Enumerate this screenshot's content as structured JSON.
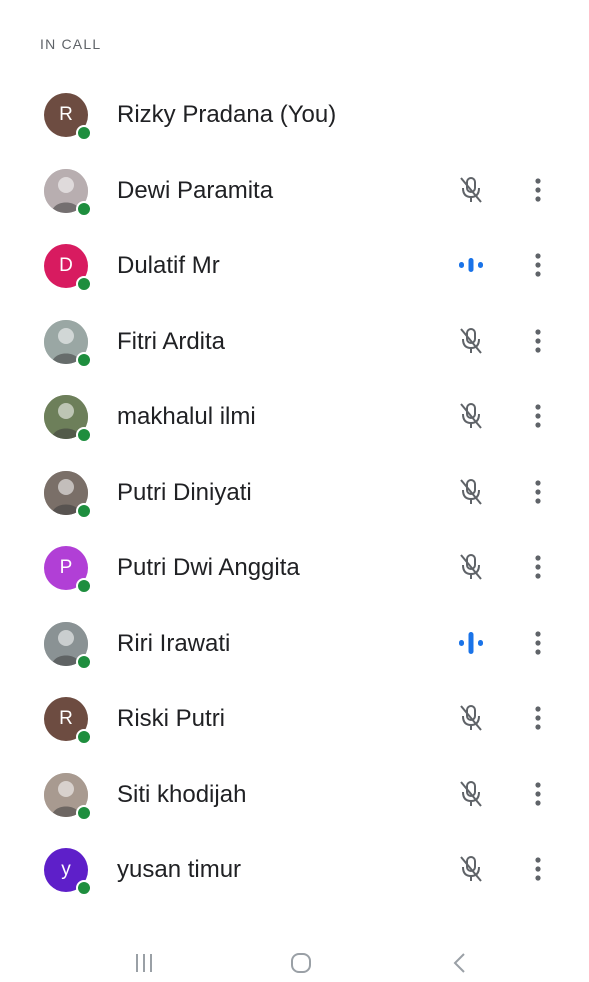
{
  "section": {
    "title": "IN CALL"
  },
  "participants": [
    {
      "name": "Rizky Pradana (You)",
      "avatar_type": "letter",
      "initial": "R",
      "avatar_color": "#6d4c41",
      "mic": "none"
    },
    {
      "name": "Dewi Paramita",
      "avatar_type": "photo",
      "initial": "",
      "avatar_color": "#b8aeb0",
      "mic": "muted"
    },
    {
      "name": "Dulatif Mr",
      "avatar_type": "letter",
      "initial": "D",
      "avatar_color": "#d81b60",
      "mic": "speaking"
    },
    {
      "name": "Fitri Ardita",
      "avatar_type": "photo",
      "initial": "",
      "avatar_color": "#9aa7a4",
      "mic": "muted"
    },
    {
      "name": "makhalul ilmi",
      "avatar_type": "photo",
      "initial": "",
      "avatar_color": "#6d7f5a",
      "mic": "muted"
    },
    {
      "name": "Putri Diniyati",
      "avatar_type": "photo",
      "initial": "",
      "avatar_color": "#7a6f68",
      "mic": "muted"
    },
    {
      "name": "Putri Dwi Anggita",
      "avatar_type": "letter",
      "initial": "P",
      "avatar_color": "#b13fd6",
      "mic": "muted"
    },
    {
      "name": "Riri Irawati",
      "avatar_type": "photo",
      "initial": "",
      "avatar_color": "#8a9294",
      "mic": "speaking"
    },
    {
      "name": "Riski Putri",
      "avatar_type": "letter",
      "initial": "R",
      "avatar_color": "#6d4c41",
      "mic": "muted"
    },
    {
      "name": "Siti khodijah",
      "avatar_type": "photo",
      "initial": "",
      "avatar_color": "#a89a90",
      "mic": "muted"
    },
    {
      "name": "yusan timur",
      "avatar_type": "letter",
      "initial": "y",
      "avatar_color": "#5e1fc9",
      "mic": "muted"
    }
  ],
  "colors": {
    "online": "#1e8e3e",
    "speaking": "#1a73e8",
    "icon_gray": "#5f6368"
  },
  "icons": {
    "muted": "mic-off-icon",
    "speaking": "audio-level-icon",
    "more": "more-vert-icon",
    "nav_recents": "recents-icon",
    "nav_home": "home-icon",
    "nav_back": "back-icon"
  }
}
